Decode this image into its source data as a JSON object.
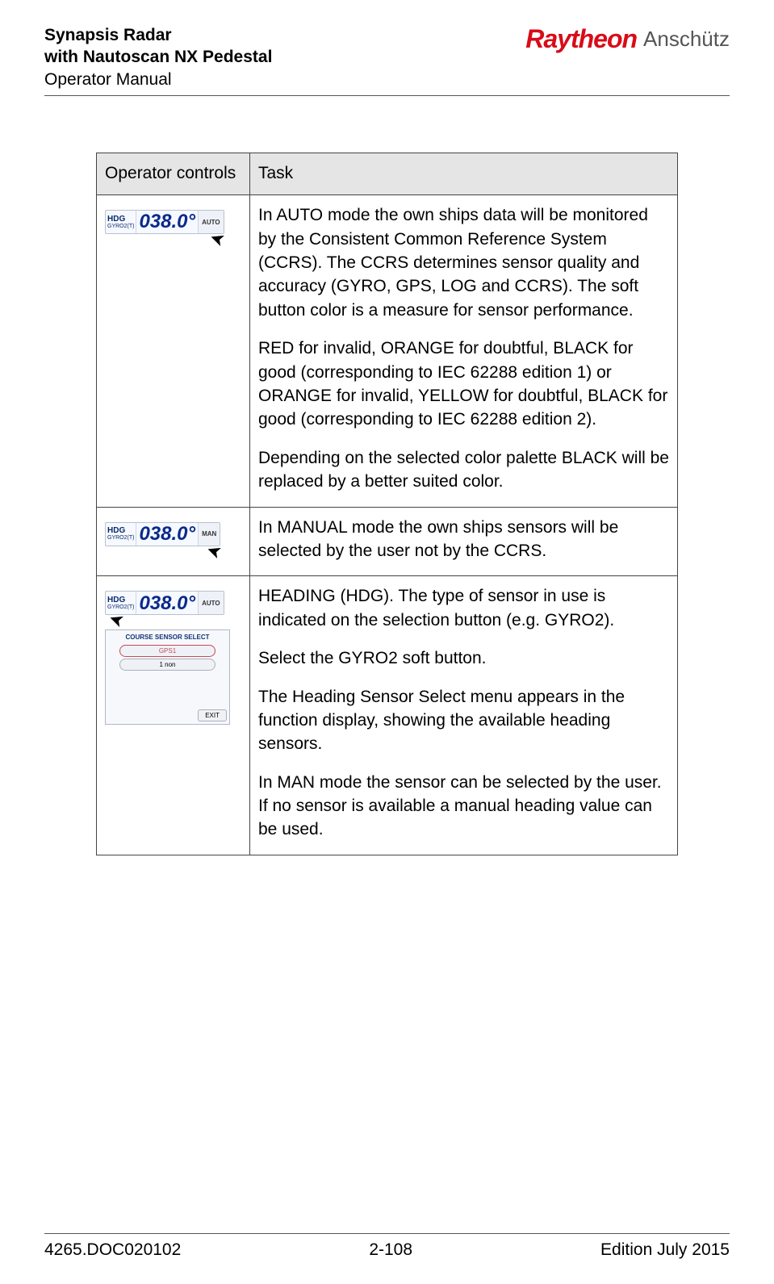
{
  "header": {
    "product_line1": "Synapsis Radar",
    "product_line2": "with Nautoscan NX Pedestal",
    "subtitle": "Operator Manual",
    "logo_primary": "Raytheon",
    "logo_secondary": "Anschütz"
  },
  "table": {
    "col1_header": "Operator controls",
    "col2_header": "Task",
    "rows": [
      {
        "widget": {
          "hdg_label": "HDG",
          "gyro_label": "GYRO2(T)",
          "value": "038.0°",
          "mode": "AUTO",
          "cursor_target": "mode"
        },
        "menu": null,
        "paragraphs": [
          "In AUTO mode the own ships data will be monitored by the Consistent Common Reference System (CCRS). The CCRS determines sensor quality and accuracy (GYRO, GPS, LOG and CCRS). The soft button color is a measure for sensor performance.",
          "RED for invalid, ORANGE for doubtful, BLACK for good (corresponding to IEC 62288 edition 1) or ORANGE for invalid, YELLOW for doubtful, BLACK for good (corresponding to IEC 62288 edition 2).",
          "Depending on the selected color palette BLACK will be replaced by a better suited color."
        ]
      },
      {
        "widget": {
          "hdg_label": "HDG",
          "gyro_label": "GYRO2(T)",
          "value": "038.0°",
          "mode": "MAN",
          "cursor_target": "mode"
        },
        "menu": null,
        "paragraphs": [
          "In MANUAL mode the own ships sensors will be selected by the user not by the CCRS."
        ]
      },
      {
        "widget": {
          "hdg_label": "HDG",
          "gyro_label": "GYRO2(T)",
          "value": "038.0°",
          "mode": "AUTO",
          "cursor_target": "gyro"
        },
        "menu": {
          "title": "COURSE SENSOR SELECT",
          "options": [
            "GPS1",
            "1 non"
          ],
          "selected_index": 0,
          "exit_label": "EXIT"
        },
        "paragraphs": [
          "HEADING (HDG). The type of sensor in use is indicated on the selection button (e.g. GYRO2).",
          "Select the GYRO2 soft button.",
          "The Heading Sensor Select menu appears in the function display, showing the available heading sensors.",
          "In MAN mode the sensor can be selected by the user. If no sensor is available a manual heading value can be used."
        ]
      }
    ]
  },
  "footer": {
    "doc_id": "4265.DOC020102",
    "page": "2-108",
    "edition": "Edition July 2015"
  }
}
